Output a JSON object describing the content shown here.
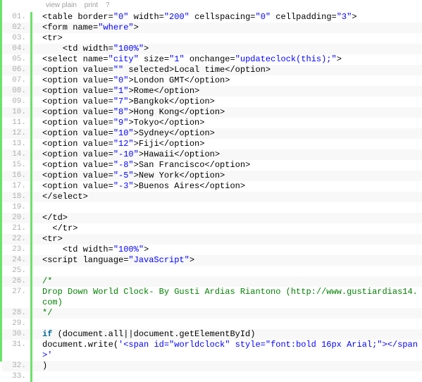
{
  "toolbar": {
    "view_plain": "view plain",
    "print": "print",
    "help": "?"
  },
  "lines": [
    {
      "num": "01.",
      "indent": "",
      "tokens": [
        [
          "plain",
          "<table border="
        ],
        [
          "string",
          "\"0\""
        ],
        [
          "plain",
          " width="
        ],
        [
          "string",
          "\"200\""
        ],
        [
          "plain",
          " cellspacing="
        ],
        [
          "string",
          "\"0\""
        ],
        [
          "plain",
          " cellpadding="
        ],
        [
          "string",
          "\"3\""
        ],
        [
          "plain",
          ">"
        ]
      ]
    },
    {
      "num": "02.",
      "indent": "",
      "tokens": [
        [
          "plain",
          "<form name="
        ],
        [
          "string",
          "\"where\""
        ],
        [
          "plain",
          ">"
        ]
      ]
    },
    {
      "num": "03.",
      "indent": "",
      "tokens": [
        [
          "plain",
          "<tr>"
        ]
      ]
    },
    {
      "num": "04.",
      "indent": "    ",
      "tokens": [
        [
          "plain",
          "<td width="
        ],
        [
          "string",
          "\"100%\""
        ],
        [
          "plain",
          ">"
        ]
      ]
    },
    {
      "num": "05.",
      "indent": "",
      "tokens": [
        [
          "plain",
          "<select name="
        ],
        [
          "string",
          "\"city\""
        ],
        [
          "plain",
          " size="
        ],
        [
          "string",
          "\"1\""
        ],
        [
          "plain",
          " onchange="
        ],
        [
          "string",
          "\"updateclock(this);\""
        ],
        [
          "plain",
          ">"
        ]
      ]
    },
    {
      "num": "06.",
      "indent": "",
      "tokens": [
        [
          "plain",
          "<option value="
        ],
        [
          "string",
          "\"\""
        ],
        [
          "plain",
          " selected>Local time</option>"
        ]
      ]
    },
    {
      "num": "07.",
      "indent": "",
      "tokens": [
        [
          "plain",
          "<option value="
        ],
        [
          "string",
          "\"0\""
        ],
        [
          "plain",
          ">London GMT</option>"
        ]
      ]
    },
    {
      "num": "08.",
      "indent": "",
      "tokens": [
        [
          "plain",
          "<option value="
        ],
        [
          "string",
          "\"1\""
        ],
        [
          "plain",
          ">Rome</option>"
        ]
      ]
    },
    {
      "num": "09.",
      "indent": "",
      "tokens": [
        [
          "plain",
          "<option value="
        ],
        [
          "string",
          "\"7\""
        ],
        [
          "plain",
          ">Bangkok</option>"
        ]
      ]
    },
    {
      "num": "10.",
      "indent": "",
      "tokens": [
        [
          "plain",
          "<option value="
        ],
        [
          "string",
          "\"8\""
        ],
        [
          "plain",
          ">Hong Kong</option>"
        ]
      ]
    },
    {
      "num": "11.",
      "indent": "",
      "tokens": [
        [
          "plain",
          "<option value="
        ],
        [
          "string",
          "\"9\""
        ],
        [
          "plain",
          ">Tokyo</option>"
        ]
      ]
    },
    {
      "num": "12.",
      "indent": "",
      "tokens": [
        [
          "plain",
          "<option value="
        ],
        [
          "string",
          "\"10\""
        ],
        [
          "plain",
          ">Sydney</option>"
        ]
      ]
    },
    {
      "num": "13.",
      "indent": "",
      "tokens": [
        [
          "plain",
          "<option value="
        ],
        [
          "string",
          "\"12\""
        ],
        [
          "plain",
          ">Fiji</option>"
        ]
      ]
    },
    {
      "num": "14.",
      "indent": "",
      "tokens": [
        [
          "plain",
          "<option value="
        ],
        [
          "string",
          "\"-10\""
        ],
        [
          "plain",
          ">Hawaii</option>"
        ]
      ]
    },
    {
      "num": "15.",
      "indent": "",
      "tokens": [
        [
          "plain",
          "<option value="
        ],
        [
          "string",
          "\"-8\""
        ],
        [
          "plain",
          ">San Francisco</option>"
        ]
      ]
    },
    {
      "num": "16.",
      "indent": "",
      "tokens": [
        [
          "plain",
          "<option value="
        ],
        [
          "string",
          "\"-5\""
        ],
        [
          "plain",
          ">New York</option>"
        ]
      ]
    },
    {
      "num": "17.",
      "indent": "",
      "tokens": [
        [
          "plain",
          "<option value="
        ],
        [
          "string",
          "\"-3\""
        ],
        [
          "plain",
          ">Buenos Aires</option>"
        ]
      ]
    },
    {
      "num": "18.",
      "indent": "",
      "tokens": [
        [
          "plain",
          "</select>"
        ]
      ]
    },
    {
      "num": "19.",
      "indent": "",
      "tokens": [
        [
          "plain",
          " "
        ]
      ]
    },
    {
      "num": "20.",
      "indent": "",
      "tokens": [
        [
          "plain",
          "</td>"
        ]
      ]
    },
    {
      "num": "21.",
      "indent": "  ",
      "tokens": [
        [
          "plain",
          "</tr>"
        ]
      ]
    },
    {
      "num": "22.",
      "indent": "",
      "tokens": [
        [
          "plain",
          "<tr>"
        ]
      ]
    },
    {
      "num": "23.",
      "indent": "    ",
      "tokens": [
        [
          "plain",
          "<td width="
        ],
        [
          "string",
          "\"100%\""
        ],
        [
          "plain",
          ">"
        ]
      ]
    },
    {
      "num": "24.",
      "indent": "",
      "tokens": [
        [
          "plain",
          "<script language="
        ],
        [
          "string",
          "\"JavaScript\""
        ],
        [
          "plain",
          ">"
        ]
      ]
    },
    {
      "num": "25.",
      "indent": "",
      "tokens": [
        [
          "plain",
          " "
        ]
      ]
    },
    {
      "num": "26.",
      "indent": "",
      "tokens": [
        [
          "comment",
          "/*"
        ]
      ]
    },
    {
      "num": "27.",
      "indent": "",
      "tokens": [
        [
          "comment",
          "Drop Down World Clock- By Gusti Ardias Riantono (http://www.gustiardias14.com)"
        ]
      ]
    },
    {
      "num": "28.",
      "indent": "",
      "tokens": [
        [
          "comment",
          "*/"
        ]
      ]
    },
    {
      "num": "29.",
      "indent": "",
      "tokens": [
        [
          "plain",
          " "
        ]
      ]
    },
    {
      "num": "30.",
      "indent": "",
      "tokens": [
        [
          "keyword",
          "if"
        ],
        [
          "plain",
          " (document.all||document.getElementById)"
        ]
      ]
    },
    {
      "num": "31.",
      "indent": "",
      "tokens": [
        [
          "plain",
          "document.write("
        ],
        [
          "string",
          "'<span id=\"worldclock\" style=\"font:bold 16px Arial;\"></span>'"
        ]
      ]
    },
    {
      "num": "32.",
      "indent": "",
      "tokens": [
        [
          "plain",
          ")"
        ]
      ]
    },
    {
      "num": "33.",
      "indent": "",
      "tokens": [
        [
          "plain",
          " "
        ]
      ]
    }
  ]
}
